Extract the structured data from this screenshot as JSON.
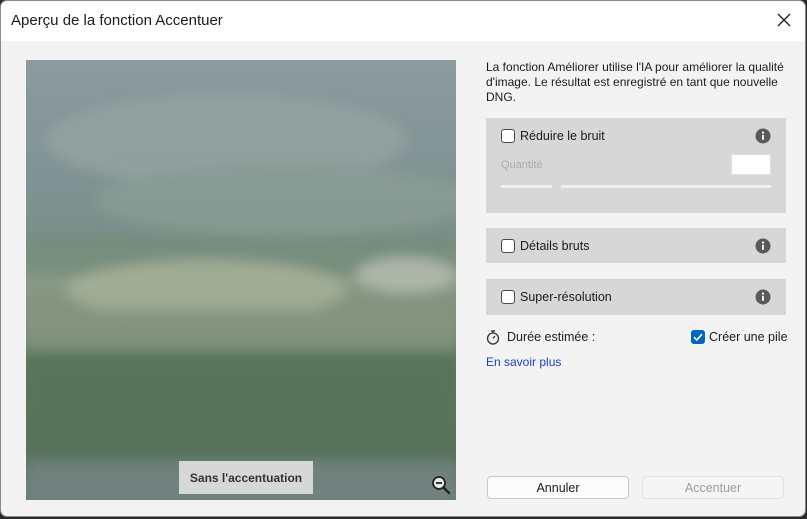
{
  "window": {
    "title": "Aperçu de la fonction Accentuer"
  },
  "preview": {
    "overlay_label": "Sans l'accentuation",
    "zoom_icon": "zoom-out-icon"
  },
  "description": "La fonction Améliorer utilise l'IA pour améliorer la qualité d'image. Le résultat est enregistré en tant que nouvelle DNG.",
  "options": {
    "noise": {
      "label": "Réduire le bruit",
      "checked": false,
      "quantity_label": "Quantité"
    },
    "raw_details": {
      "label": "Détails bruts",
      "checked": false
    },
    "super_resolution": {
      "label": "Super-résolution",
      "checked": false
    }
  },
  "footer": {
    "duration_label": "Durée estimée :",
    "stack_label": "Créer une pile",
    "stack_checked": true,
    "learn_more": "En savoir plus",
    "cancel_label": "Annuler",
    "apply_label": "Accentuer"
  },
  "colors": {
    "accent": "#0067c0",
    "link": "#1a3fcc",
    "panel": "#d7d7d7"
  }
}
